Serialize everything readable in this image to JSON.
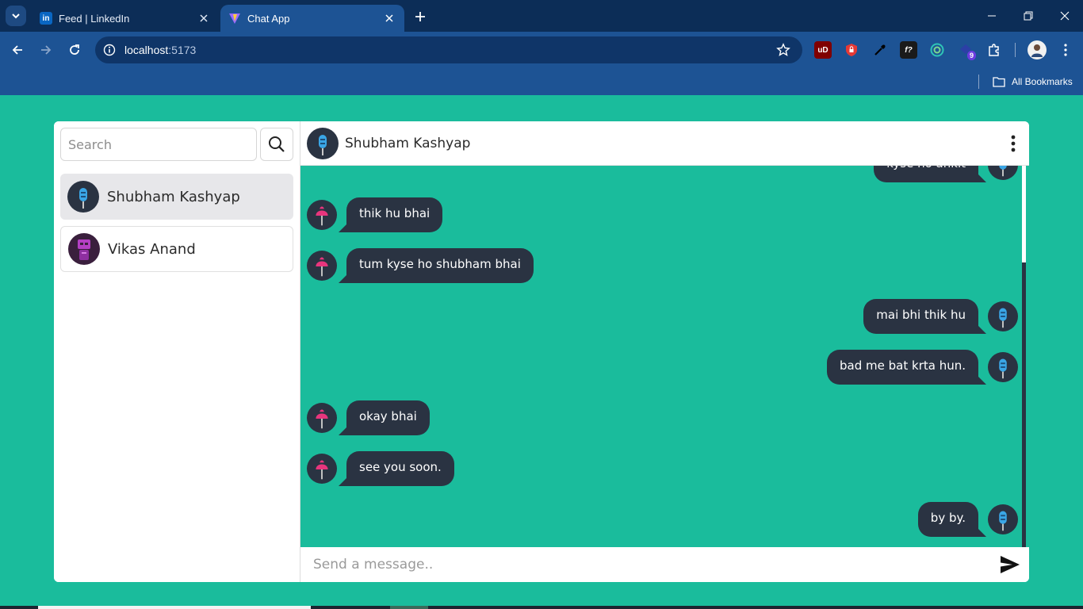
{
  "browser": {
    "tabs": [
      {
        "title": "Feed | LinkedIn",
        "favicon": "linkedin-icon",
        "favicon_label": "in",
        "active": false
      },
      {
        "title": "Chat App",
        "favicon": "vite-icon",
        "active": true
      }
    ],
    "address": {
      "host": "localhost",
      "port": ":5173"
    },
    "extensions": [
      {
        "name": "ublock-icon",
        "label": "uD",
        "color": "#c0392b"
      },
      {
        "name": "lock-extension-icon",
        "label": "",
        "color": "#e53935"
      },
      {
        "name": "color-picker-icon",
        "label": "",
        "color": "#000000"
      },
      {
        "name": "font-icon",
        "label": "f?",
        "color": "#1a1a1a"
      },
      {
        "name": "circle-extension-icon",
        "label": "",
        "color": "#2ec4b6"
      },
      {
        "name": "extension-badge-icon",
        "label": "9",
        "color": "#6c3ce1"
      },
      {
        "name": "puzzle-icon",
        "label": "",
        "color": "#ffffff"
      }
    ],
    "bookmarks": {
      "all_label": "All Bookmarks"
    }
  },
  "app": {
    "search": {
      "placeholder": "Search"
    },
    "contacts": [
      {
        "name": "Shubham Kashyap",
        "selected": true,
        "avatar": "blue-popsicle"
      },
      {
        "name": "Vikas Anand",
        "selected": false,
        "avatar": "purple-robot"
      }
    ],
    "chat": {
      "partner_name": "Shubham Kashyap",
      "messages": [
        {
          "text": "kyse ho ankit",
          "direction": "out",
          "partial": true
        },
        {
          "text": "thik hu bhai",
          "direction": "in"
        },
        {
          "text": "tum kyse ho shubham bhai",
          "direction": "in"
        },
        {
          "text": "mai bhi thik hu",
          "direction": "out"
        },
        {
          "text": "bad me bat krta hun.",
          "direction": "out"
        },
        {
          "text": "okay bhai",
          "direction": "in"
        },
        {
          "text": "see you soon.",
          "direction": "in"
        },
        {
          "text": "by by.",
          "direction": "out"
        }
      ],
      "composer_placeholder": "Send a message.."
    }
  },
  "colors": {
    "page_bg": "#1abc9c",
    "bubble": "#2a3342",
    "chrome_dark": "#0c2d57",
    "chrome": "#1d5394"
  }
}
